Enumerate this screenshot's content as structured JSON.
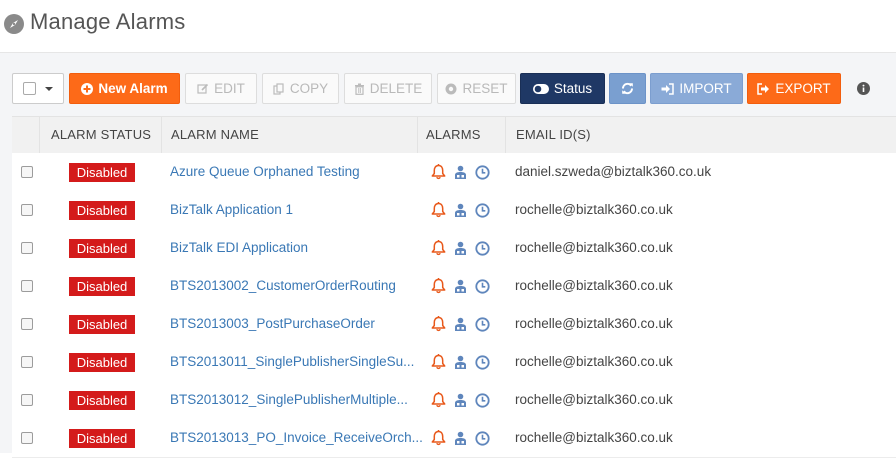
{
  "page": {
    "title": "Manage Alarms"
  },
  "toolbar": {
    "new_alarm": "New Alarm",
    "edit": "EDIT",
    "copy": "COPY",
    "delete": "DELETE",
    "reset": "RESET",
    "status": "Status",
    "import": "IMPORT",
    "export": "EXPORT"
  },
  "table": {
    "headers": {
      "status": "ALARM STATUS",
      "name": "ALARM NAME",
      "alarms": "ALARMS",
      "email": "EMAIL ID(S)"
    },
    "rows": [
      {
        "status": "Disabled",
        "name": "Azure Queue Orphaned Testing",
        "email": "daniel.szweda@biztalk360.co.uk"
      },
      {
        "status": "Disabled",
        "name": "BizTalk Application 1",
        "email": "rochelle@biztalk360.co.uk"
      },
      {
        "status": "Disabled",
        "name": "BizTalk EDI Application",
        "email": "rochelle@biztalk360.co.uk"
      },
      {
        "status": "Disabled",
        "name": "BTS2013002_CustomerOrderRouting",
        "email": "rochelle@biztalk360.co.uk"
      },
      {
        "status": "Disabled",
        "name": "BTS2013003_PostPurchaseOrder",
        "email": "rochelle@biztalk360.co.uk"
      },
      {
        "status": "Disabled",
        "name": "BTS2013011_SinglePublisherSingleSu...",
        "email": "rochelle@biztalk360.co.uk"
      },
      {
        "status": "Disabled",
        "name": "BTS2013012_SinglePublisherMultiple...",
        "email": "rochelle@biztalk360.co.uk"
      },
      {
        "status": "Disabled",
        "name": "BTS2013013_PO_Invoice_ReceiveOrch...",
        "email": "rochelle@biztalk360.co.uk"
      }
    ]
  },
  "icons": {
    "row_alarm_types": [
      "bell-icon",
      "user-group-icon",
      "clock-icon"
    ],
    "colors": {
      "bell": "#e8581a",
      "user": "#5f86bc",
      "clock": "#5f86bc",
      "disabled_badge": "#d41b1b",
      "primary_orange": "#fd6a18",
      "navy": "#1f3865"
    }
  }
}
